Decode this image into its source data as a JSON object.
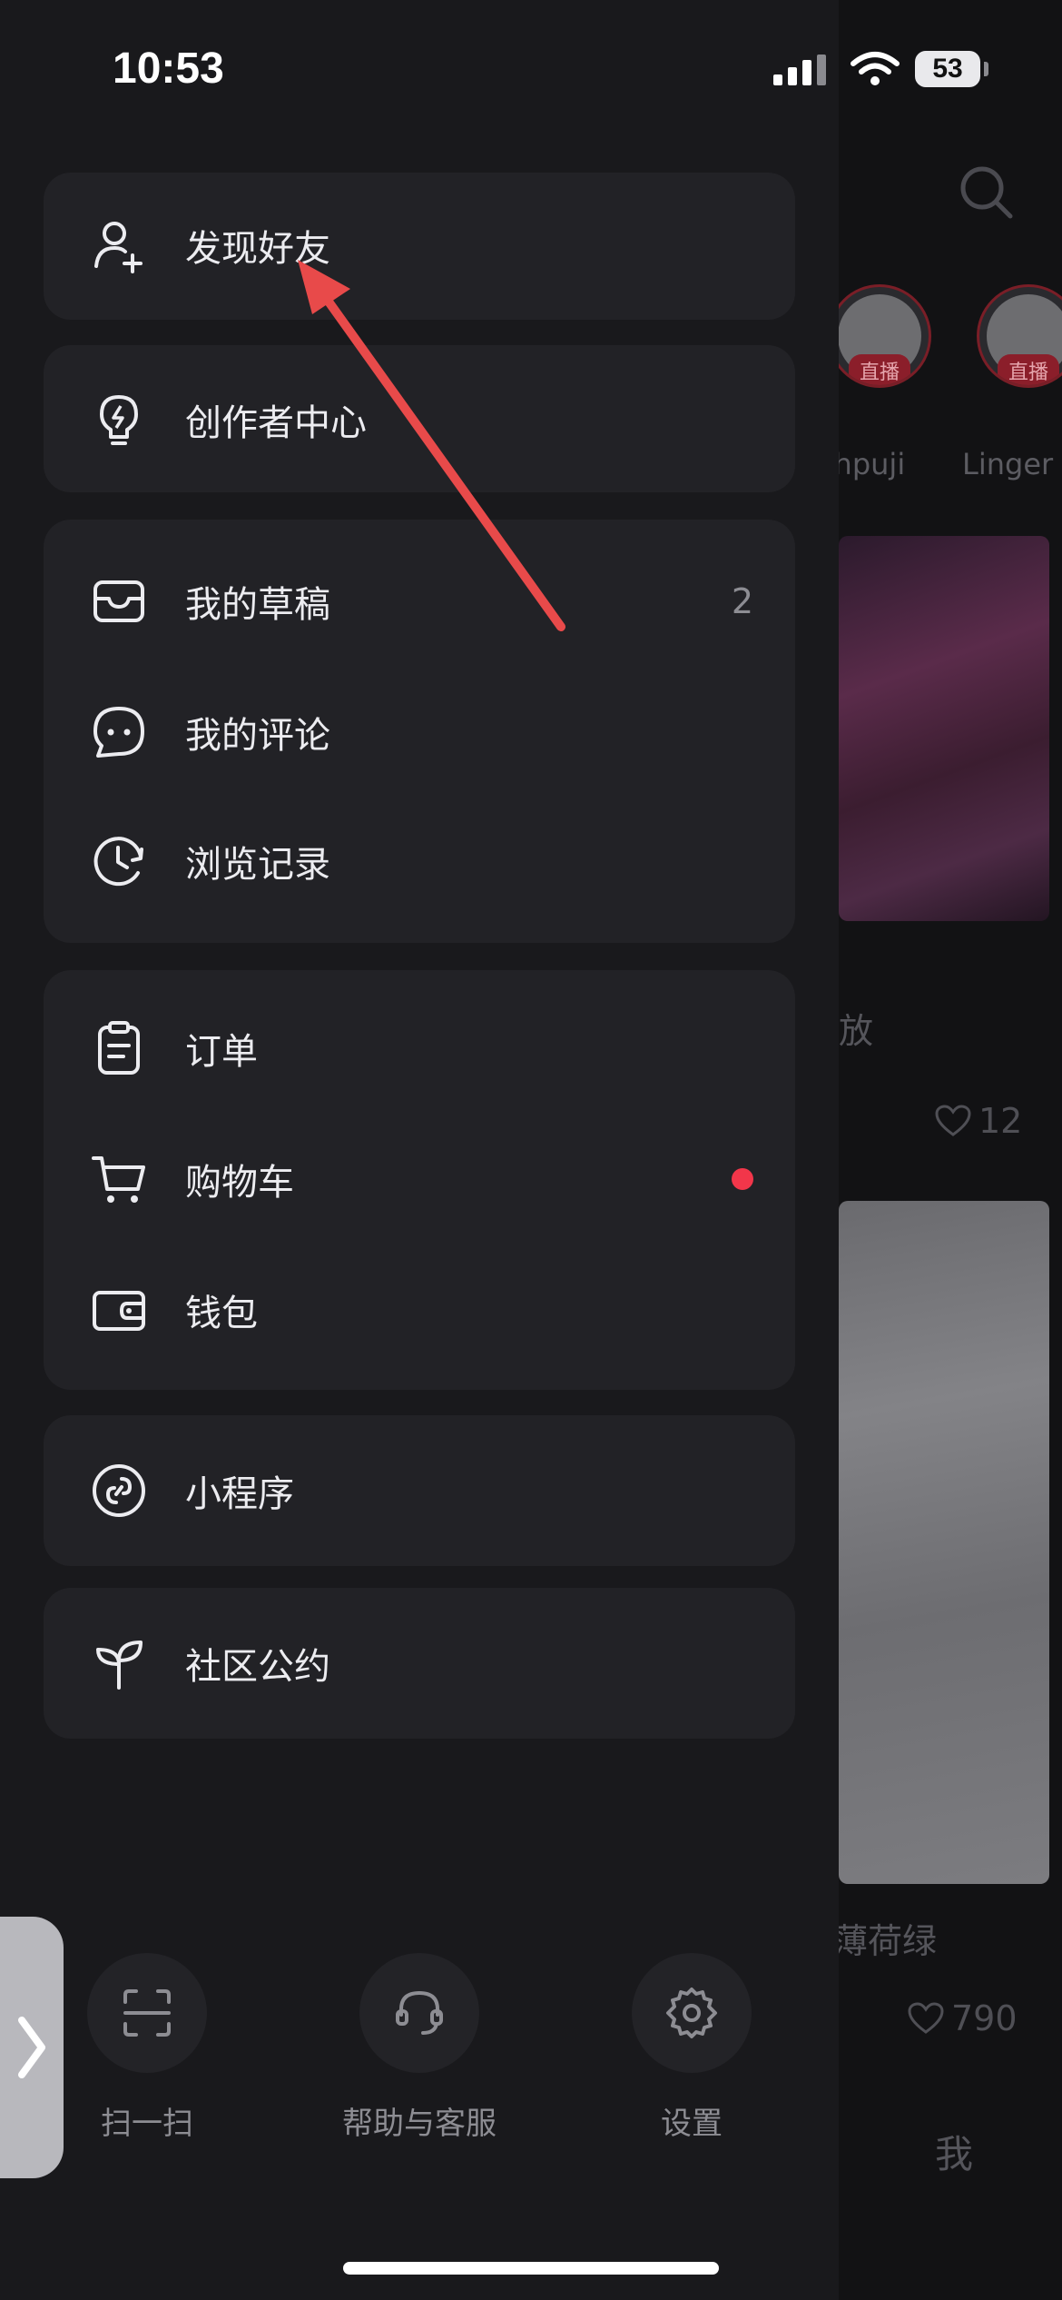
{
  "status_bar": {
    "time": "10:53",
    "battery": "53"
  },
  "background_feed": {
    "stories": [
      {
        "name": "thpuji",
        "badge": "直播"
      },
      {
        "name": "Linger",
        "badge": "直播"
      }
    ],
    "post1_title": "放",
    "post1_likes": "12",
    "post2_title": "薄荷绿",
    "post2_likes": "790",
    "me_tab": "我"
  },
  "menu": {
    "find_friends": "发现好友",
    "creator_center": "创作者中心",
    "drafts": "我的草稿",
    "drafts_count": "2",
    "comments": "我的评论",
    "history": "浏览记录",
    "orders": "订单",
    "cart": "购物车",
    "wallet": "钱包",
    "mini_programs": "小程序",
    "community_rules": "社区公约"
  },
  "bottom_actions": {
    "scan": "扫一扫",
    "help": "帮助与客服",
    "settings": "设置"
  },
  "colors": {
    "drawer_bg": "#19191c",
    "card_bg": "#222226",
    "accent_red": "#f2364a",
    "annotation_arrow": "#e84a4a"
  },
  "icons": {
    "find_friends": "person-add-icon",
    "creator_center": "lightbulb-icon",
    "drafts": "inbox-icon",
    "comments": "chat-bubble-icon",
    "history": "clock-history-icon",
    "orders": "clipboard-icon",
    "cart": "cart-icon",
    "wallet": "wallet-icon",
    "mini_programs": "link-circle-icon",
    "community_rules": "sprout-icon"
  }
}
